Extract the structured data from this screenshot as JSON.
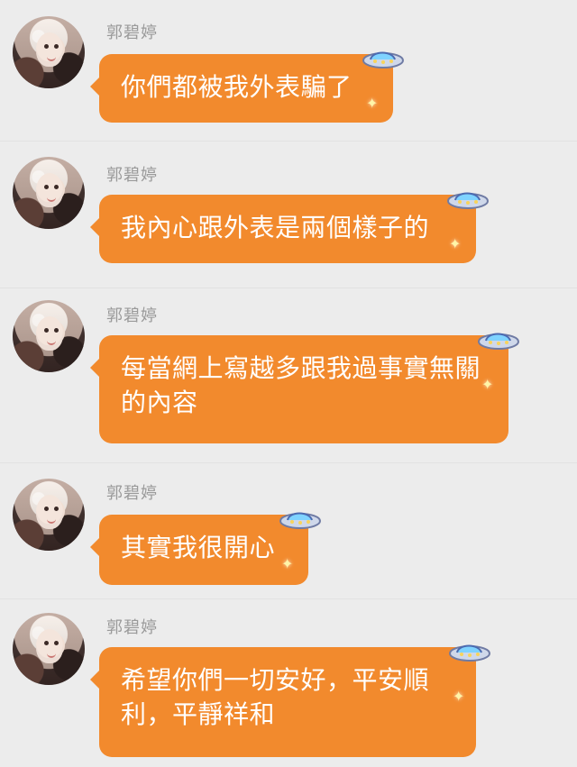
{
  "chat": {
    "messages": [
      {
        "sender": "郭碧婷",
        "text": "你們都被我外表騙了"
      },
      {
        "sender": "郭碧婷",
        "text": "我內心跟外表是兩個樣子的"
      },
      {
        "sender": "郭碧婷",
        "text": "每當網上寫越多跟我過事實無關的內容"
      },
      {
        "sender": "郭碧婷",
        "text": "其實我很開心"
      },
      {
        "sender": "郭碧婷",
        "text": "希望你們一切安好，平安順利，平靜祥和"
      }
    ]
  },
  "ui": {
    "background": "#ececec",
    "bubble_color": "#f28a2d",
    "sender_color": "#9a9a9a",
    "avatar_icon": "profile-photo",
    "decorative_icon": "ufo-sparkle-icon"
  }
}
